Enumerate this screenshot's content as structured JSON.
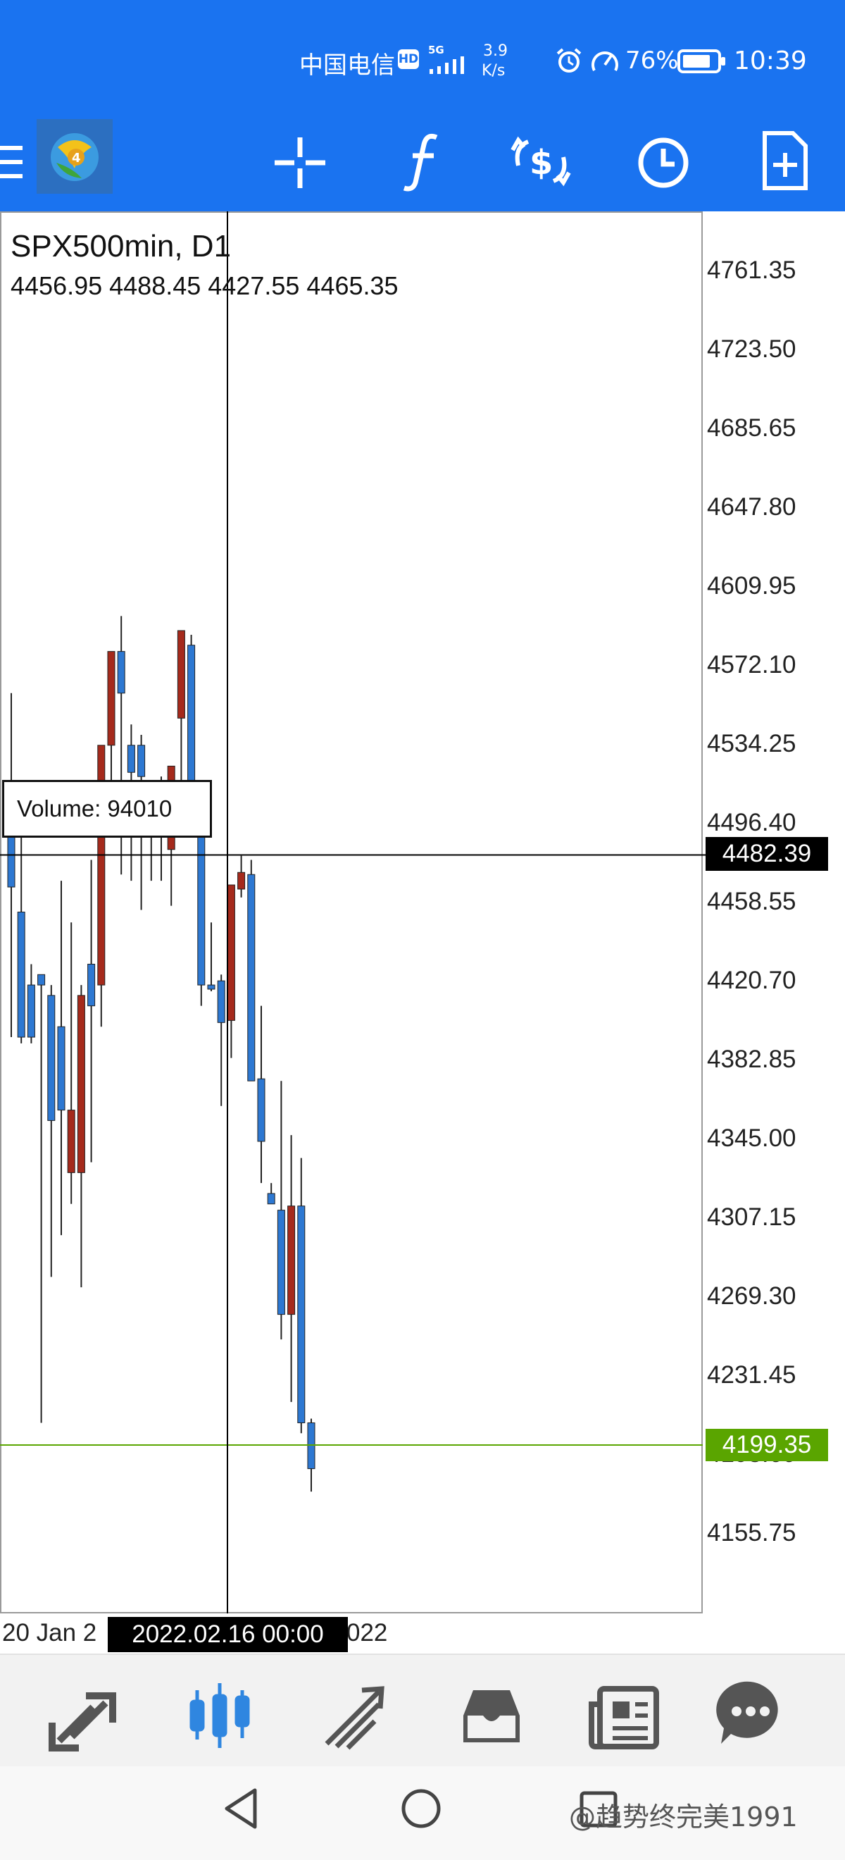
{
  "status_bar": {
    "carrier": "中国电信",
    "hd": "HD",
    "network": "5G",
    "net_speed_value": "3.9",
    "net_speed_unit": "K/s",
    "battery": "76%",
    "time": "10:39"
  },
  "toolbar": {
    "icons": [
      "menu-icon",
      "app-logo",
      "crosshair-icon",
      "indicators-icon",
      "trade-icon",
      "timeframe-icon",
      "new-order-icon"
    ]
  },
  "chart": {
    "symbol_title": "SPX500min, D1",
    "ohlc_line": "4456.95 4488.45 4427.55 4465.35",
    "volume_tooltip": "Volume: 94010",
    "price_labels": [
      "4761.35",
      "4723.50",
      "4685.65",
      "4647.80",
      "4609.95",
      "4572.10",
      "4534.25",
      "4496.40",
      "4458.55",
      "4420.70",
      "4382.85",
      "4345.00",
      "4307.15",
      "4269.30",
      "4231.45",
      "4193.60",
      "4155.75"
    ],
    "crosshair_price": "4482.39",
    "bid_price": "4199.35",
    "date_left": "20 Jan 2",
    "crosshair_date": "2022.02.16 00:00",
    "date_right": "022",
    "colors": {
      "bull": "#2d78d2",
      "bear": "#a52a1c",
      "bid_line": "#5aa500",
      "accent": "#1a73f0"
    }
  },
  "chart_data": {
    "type": "candlestick",
    "title": "SPX500min, D1",
    "ylim": [
      4140,
      4790
    ],
    "candles": [
      {
        "open": 4515,
        "high": 4560,
        "low": 4395,
        "close": 4467
      },
      {
        "open": 4455,
        "high": 4510,
        "low": 4392,
        "close": 4395
      },
      {
        "open": 4395,
        "high": 4430,
        "low": 4392,
        "close": 4420
      },
      {
        "open": 4420,
        "high": 4425,
        "low": 4210,
        "close": 4425
      },
      {
        "open": 4415,
        "high": 4420,
        "low": 4280,
        "close": 4355
      },
      {
        "open": 4400,
        "high": 4470,
        "low": 4300,
        "close": 4360
      },
      {
        "open": 4360,
        "high": 4450,
        "low": 4315,
        "close": 4330
      },
      {
        "open": 4330,
        "high": 4420,
        "low": 4275,
        "close": 4415
      },
      {
        "open": 4410,
        "high": 4480,
        "low": 4335,
        "close": 4430
      },
      {
        "open": 4420,
        "high": 4510,
        "low": 4400,
        "close": 4535
      },
      {
        "open": 4535,
        "high": 4550,
        "low": 4500,
        "close": 4580
      },
      {
        "open": 4560,
        "high": 4597,
        "low": 4473,
        "close": 4580
      },
      {
        "open": 4522,
        "high": 4545,
        "low": 4470,
        "close": 4535
      },
      {
        "open": 4535,
        "high": 4540,
        "low": 4456,
        "close": 4520
      },
      {
        "open": 4500,
        "high": 4505,
        "low": 4470,
        "close": 4510
      },
      {
        "open": 4505,
        "high": 4520,
        "low": 4470,
        "close": 4505
      },
      {
        "open": 4485,
        "high": 4520,
        "low": 4458,
        "close": 4525
      },
      {
        "open": 4548,
        "high": 4590,
        "low": 4498,
        "close": 4590
      },
      {
        "open": 4583,
        "high": 4588,
        "low": 4495,
        "close": 4502
      },
      {
        "open": 4500,
        "high": 4510,
        "low": 4410,
        "close": 4420
      },
      {
        "open": 4418,
        "high": 4450,
        "low": 4417,
        "close": 4420
      },
      {
        "open": 4422,
        "high": 4425,
        "low": 4362,
        "close": 4402
      },
      {
        "open": 4403,
        "high": 4405,
        "low": 4385,
        "close": 4468
      },
      {
        "open": 4466,
        "high": 4482,
        "low": 4462,
        "close": 4474
      },
      {
        "open": 4473,
        "high": 4480,
        "low": 4375,
        "close": 4374
      },
      {
        "open": 4375,
        "high": 4410,
        "low": 4325,
        "close": 4345
      },
      {
        "open": 4320,
        "high": 4325,
        "low": 4318,
        "close": 4315
      },
      {
        "open": 4312,
        "high": 4374,
        "low": 4250,
        "close": 4262
      },
      {
        "open": 4262,
        "high": 4348,
        "low": 4220,
        "close": 4314
      },
      {
        "open": 4314,
        "high": 4337,
        "low": 4205,
        "close": 4210
      },
      {
        "open": 4210,
        "high": 4212,
        "low": 4177,
        "close": 4188
      }
    ],
    "candle_colors": [
      "bull",
      "bull",
      "bull",
      "bull",
      "bull",
      "bull",
      "bear",
      "bear",
      "bull",
      "bear",
      "bear",
      "bull",
      "bull",
      "bull",
      "bull",
      "bull",
      "bear",
      "bear",
      "bull",
      "bull",
      "bull",
      "bull",
      "bear",
      "bear",
      "bull",
      "bull",
      "bull",
      "bull",
      "bear",
      "bull",
      "bull"
    ],
    "crosshair": {
      "price": 4482.39,
      "date": "2022.02.16 00:00"
    },
    "bid_line": 4199.35
  },
  "bottom_tabs": [
    "quotes-tab",
    "chart-tab",
    "trade-tab",
    "history-tab",
    "news-tab",
    "chat-tab"
  ],
  "watermark": "@趋势终完美1991"
}
